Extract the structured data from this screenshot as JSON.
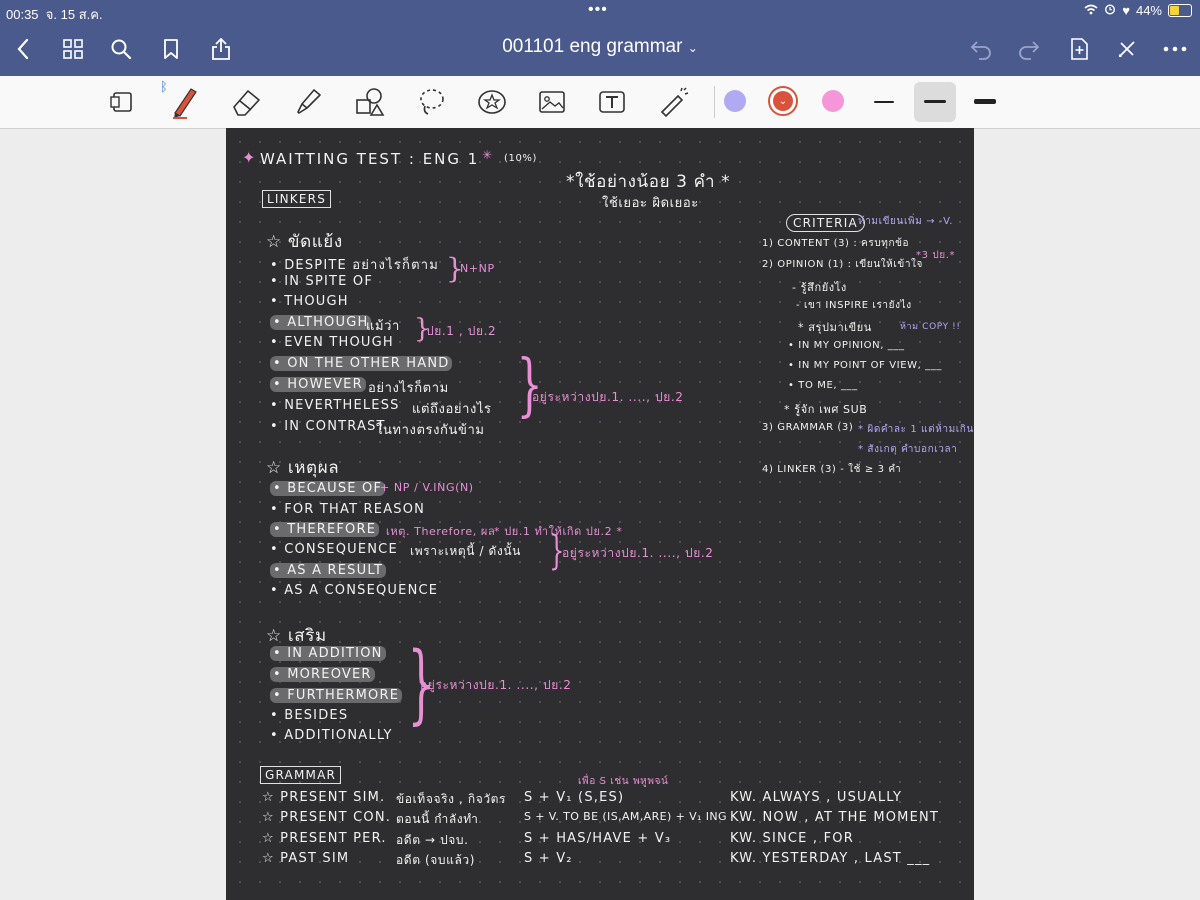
{
  "status": {
    "time": "00:35",
    "date": "จ. 15 ส.ค.",
    "battery": "44%",
    "battery_level": 0.44
  },
  "nav": {
    "title": "001101 eng grammar",
    "icons": [
      "back-icon",
      "grid-icon",
      "search-icon",
      "bookmark-icon",
      "share-icon",
      "undo-icon",
      "redo-icon",
      "add-page-icon",
      "close-pen-icon",
      "more-icon"
    ]
  },
  "toolbar": {
    "tools": [
      "lasso-reading-icon",
      "pen-icon",
      "eraser-icon",
      "highlighter-icon",
      "shapes-icon",
      "lasso-icon",
      "sticker-icon",
      "image-icon",
      "text-icon",
      "laser-icon"
    ],
    "colors": [
      "#b0aaf2",
      "#d9533c",
      "#f596d8"
    ],
    "selected_color": "#d9533c",
    "bluetooth": "ᛒ"
  },
  "note": {
    "title": "WAITTING TEST : ENG 1",
    "title_percent": "(10%)",
    "subtitle_th": "*ใช้อย่างน้อย 3 คำ *",
    "subtitle_th2": "ใช้เยอะ ผิดเยอะ",
    "linkers_heading": "LINKERS",
    "contrast": {
      "heading": "☆ ขัดแย้ง",
      "items": [
        "• DESPITE  อย่างไรก็ตาม",
        "• IN SPITE  OF",
        "• THOUGH",
        "• ALTHOUGH",
        "• EVEN  THOUGH",
        "• ON THE OTHER HAND",
        "• HOWEVER",
        "• NEVERTHELESS",
        "• IN CONTRAST"
      ],
      "althouth_note": "แม้ว่า",
      "however_note": "อย่างไรก็ตาม",
      "nevertheless_note": "แต่ถึงอย่างไร",
      "contrast_note": "ในทางตรงกันข้าม",
      "np_note": "N+NP",
      "clause_note": "ปย.1 , ปย.2",
      "position_note": "อยู่ระหว่างปย.1. ...., ปย.2"
    },
    "cause": {
      "heading": "☆ เหตุผล",
      "items": [
        "• BECAUSE OF",
        "• FOR THAT REASON",
        "• THEREFORE",
        "• CONSEQUENCE",
        "• AS A RESULT",
        "• AS A CONSEQUENCE"
      ],
      "because_note": "+ NP / V.ING(N)",
      "therefore_note": "เหตุ. Therefore, ผล",
      "therefore_star": "* ปย.1 ทำให้เกิด ปย.2 *",
      "consequence_note": "เพราะเหตุนี้ / ดังนั้น",
      "position_note": "อยู่ระหว่างปย.1. ...., ปย.2"
    },
    "addition": {
      "heading": "☆ เสริม",
      "items": [
        "• IN ADDITION",
        "• MOREOVER",
        "• FURTHERMORE",
        "• BESIDES",
        "• ADDITIONALLY"
      ],
      "position_note": "อยู่ระหว่างปย.1. ...., ปย.2"
    },
    "criteria": {
      "heading": "CRITERIA",
      "heading_note": "ห้ามเขียนเพิ่ม → -V.",
      "items": [
        "1) CONTENT (3) : ครบทุกข้อ",
        "2) OPINION (1) : เขียนให้เข้าใจ",
        "- รู้สึกยังไง",
        "- เขา INSPIRE เรายังไง",
        "* สรุปมาเขียน",
        "• IN MY OPINION, ___",
        "• IN MY POINT OF VIEW, ___",
        "• TO ME, ___",
        "* รู้จัก เพศ SUB",
        "3) GRAMMAR (3)",
        "4) LINKER (3) - ใช้ ≥ 3 คำ"
      ],
      "opinion_star": "*3 ปย.*",
      "no_copy": "ห้าม COPY !!",
      "grammar_note1": "* ผิดคำละ 1 แต่ห้ามเกิน",
      "grammar_note2": "* สังเกตุ คำบอกเวลา"
    },
    "grammar": {
      "heading": "GRAMMAR",
      "annotation": "เพื่อ S เช่น พหูพจน์",
      "rows": [
        {
          "name": "☆ PRESENT SIM.",
          "th": "ข้อเท็จจริง , กิจวัตร",
          "form": "S + V₁ (S,ES)",
          "kw": "KW. ALWAYS , USUALLY"
        },
        {
          "name": "☆ PRESENT CON.",
          "th": "ตอนนี้ กำลังทำ",
          "form": "S + V. TO BE (IS,AM,ARE) + V₁ ING",
          "kw": "KW. NOW , AT THE MOMENT"
        },
        {
          "name": "☆ PRESENT PER.",
          "th": "อดีต → ปจบ.",
          "form": "S + HAS/HAVE + V₃",
          "kw": "KW. SINCE , FOR"
        },
        {
          "name": "☆ PAST SIM",
          "th": "อดีต (จบแล้ว)",
          "form": "S + V₂",
          "kw": "KW. YESTERDAY , LAST ___"
        }
      ]
    }
  }
}
